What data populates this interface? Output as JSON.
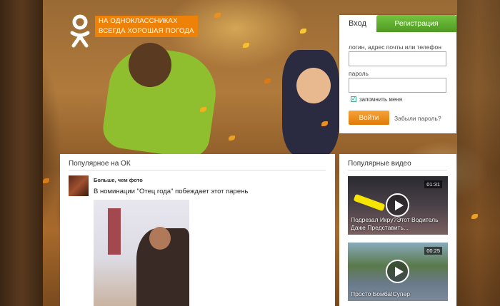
{
  "brand": {
    "slogan_line1": "НА ОДНОКЛАССНИКАХ",
    "slogan_line2": "ВСЕГДА ХОРОШАЯ ПОГОДА",
    "accent_color": "#ee8208"
  },
  "login": {
    "tab_login": "Вход",
    "tab_register": "Регистрация",
    "login_label": "логин, адрес почты или телефон",
    "login_value": "",
    "password_label": "пароль",
    "password_value": "",
    "remember_label": "запомнить меня",
    "remember_checked": true,
    "submit_label": "Войти",
    "forgot_label": "Забыли пароль?"
  },
  "feed": {
    "title": "Популярное на ОК",
    "post": {
      "group_name": "Больше, чем фото",
      "text": "В номинации \"Отец года\" побеждает этот парень"
    }
  },
  "videos": {
    "title": "Популярные видео",
    "items": [
      {
        "duration": "01:31",
        "caption": "Подрезал Икру?Этот Водитель Даже Представить..."
      },
      {
        "duration": "00:25",
        "caption": "Просто Бомба!Супер"
      }
    ]
  }
}
